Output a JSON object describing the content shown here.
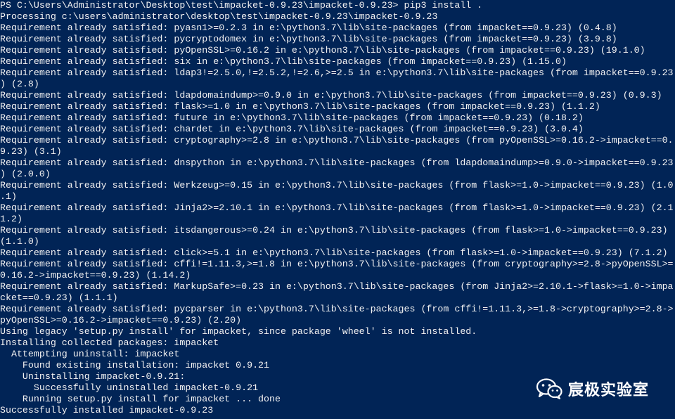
{
  "terminal": {
    "background": "#012456",
    "foreground": "#f2f2f2",
    "lines": [
      "PS C:\\Users\\Administrator\\Desktop\\test\\impacket-0.9.23\\impacket-0.9.23> pip3 install .",
      "Processing c:\\users\\administrator\\desktop\\test\\impacket-0.9.23\\impacket-0.9.23",
      "Requirement already satisfied: pyasn1>=0.2.3 in e:\\python3.7\\lib\\site-packages (from impacket==0.9.23) (0.4.8)",
      "Requirement already satisfied: pycryptodomex in e:\\python3.7\\lib\\site-packages (from impacket==0.9.23) (3.9.8)",
      "Requirement already satisfied: pyOpenSSL>=0.16.2 in e:\\python3.7\\lib\\site-packages (from impacket==0.9.23) (19.1.0)",
      "Requirement already satisfied: six in e:\\python3.7\\lib\\site-packages (from impacket==0.9.23) (1.15.0)",
      "Requirement already satisfied: ldap3!=2.5.0,!=2.5.2,!=2.6,>=2.5 in e:\\python3.7\\lib\\site-packages (from impacket==0.9.23",
      ") (2.8)",
      "Requirement already satisfied: ldapdomaindump>=0.9.0 in e:\\python3.7\\lib\\site-packages (from impacket==0.9.23) (0.9.3)",
      "Requirement already satisfied: flask>=1.0 in e:\\python3.7\\lib\\site-packages (from impacket==0.9.23) (1.1.2)",
      "Requirement already satisfied: future in e:\\python3.7\\lib\\site-packages (from impacket==0.9.23) (0.18.2)",
      "Requirement already satisfied: chardet in e:\\python3.7\\lib\\site-packages (from impacket==0.9.23) (3.0.4)",
      "Requirement already satisfied: cryptography>=2.8 in e:\\python3.7\\lib\\site-packages (from pyOpenSSL>=0.16.2->impacket==0.",
      "9.23) (3.1)",
      "Requirement already satisfied: dnspython in e:\\python3.7\\lib\\site-packages (from ldapdomaindump>=0.9.0->impacket==0.9.23",
      ") (2.0.0)",
      "Requirement already satisfied: Werkzeug>=0.15 in e:\\python3.7\\lib\\site-packages (from flask>=1.0->impacket==0.9.23) (1.0",
      ".1)",
      "Requirement already satisfied: Jinja2>=2.10.1 in e:\\python3.7\\lib\\site-packages (from flask>=1.0->impacket==0.9.23) (2.1",
      "1.2)",
      "Requirement already satisfied: itsdangerous>=0.24 in e:\\python3.7\\lib\\site-packages (from flask>=1.0->impacket==0.9.23)",
      "(1.1.0)",
      "Requirement already satisfied: click>=5.1 in e:\\python3.7\\lib\\site-packages (from flask>=1.0->impacket==0.9.23) (7.1.2)",
      "Requirement already satisfied: cffi!=1.11.3,>=1.8 in e:\\python3.7\\lib\\site-packages (from cryptography>=2.8->pyOpenSSL>=",
      "0.16.2->impacket==0.9.23) (1.14.2)",
      "Requirement already satisfied: MarkupSafe>=0.23 in e:\\python3.7\\lib\\site-packages (from Jinja2>=2.10.1->flask>=1.0->impa",
      "cket==0.9.23) (1.1.1)",
      "Requirement already satisfied: pycparser in e:\\python3.7\\lib\\site-packages (from cffi!=1.11.3,>=1.8->cryptography>=2.8->",
      "pyOpenSSL>=0.16.2->impacket==0.9.23) (2.20)",
      "Using legacy 'setup.py install' for impacket, since package 'wheel' is not installed.",
      "Installing collected packages: impacket",
      "  Attempting uninstall: impacket",
      "    Found existing installation: impacket 0.9.21",
      "    Uninstalling impacket-0.9.21:",
      "      Successfully uninstalled impacket-0.9.21",
      "    Running setup.py install for impacket ... done",
      "Successfully installed impacket-0.9.23"
    ]
  },
  "watermark": {
    "icon": "wechat-icon",
    "text": "宸极实验室"
  }
}
